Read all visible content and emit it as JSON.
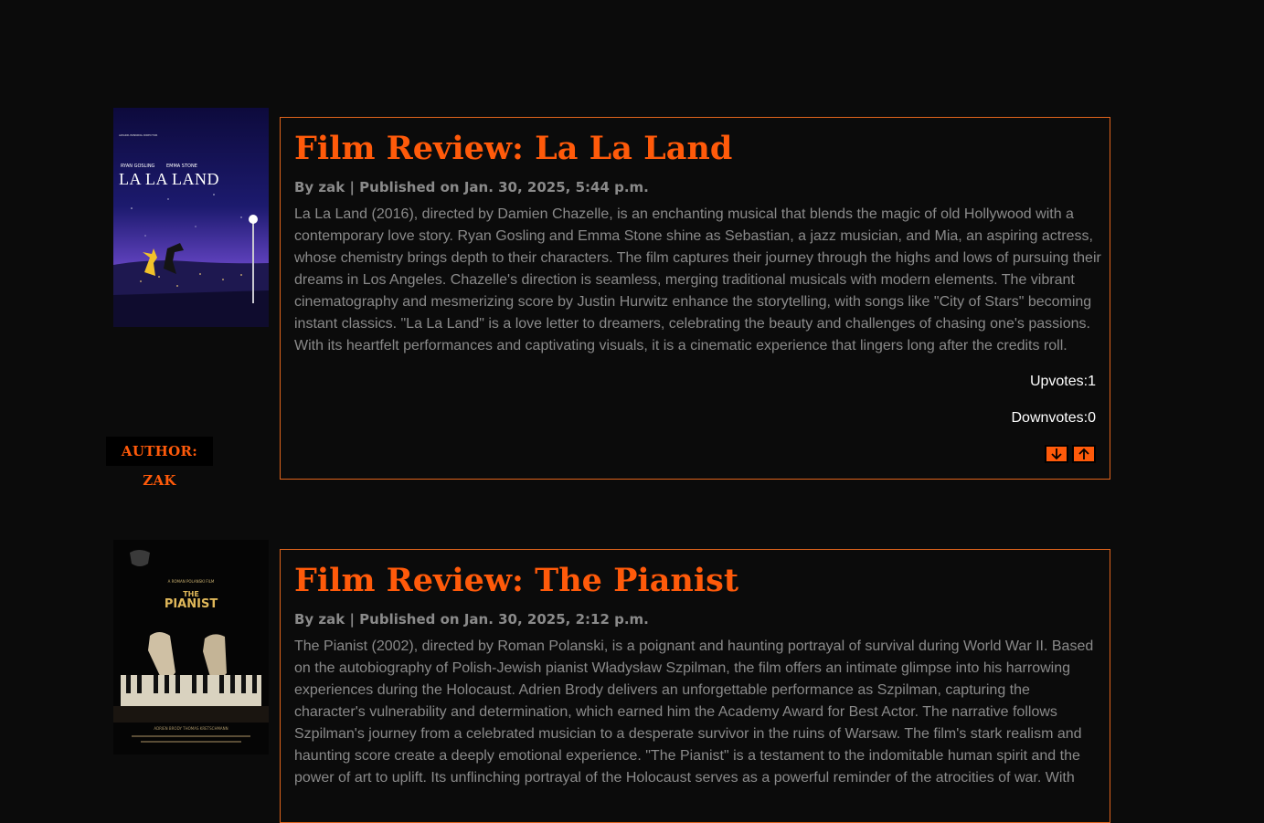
{
  "posts": [
    {
      "title": "Film Review: La La Land",
      "byline": "By zak | Published on Jan. 30, 2025, 5:44 p.m.",
      "body": "La La Land (2016), directed by Damien Chazelle, is an enchanting musical that blends the magic of old Hollywood with a contemporary love story. Ryan Gosling and Emma Stone shine as Sebastian, a jazz musician, and Mia, an aspiring actress, whose chemistry brings depth to their characters. The film captures their journey through the highs and lows of pursuing their dreams in Los Angeles. Chazelle's direction is seamless, merging traditional musicals with modern elements. The vibrant cinematography and mesmerizing score by Justin Hurwitz enhance the storytelling, with songs like \"City of Stars\" becoming instant classics. \"La La Land\" is a love letter to dreamers, celebrating the beauty and challenges of chasing one's passions. With its heartfelt performances and captivating visuals, it is a cinematic experience that lingers long after the credits roll.",
      "upvotes": "Upvotes:1",
      "downvotes": "Downvotes:0",
      "author_badge": "AUTHOR: ZAK",
      "poster": {
        "top_small_text": "AWARD-WINNING DIRECTOR",
        "actors_left": "RYAN GOSLING",
        "actors_right": "EMMA STONE",
        "title": "LA LA LAND"
      }
    },
    {
      "title": "Film Review: The Pianist",
      "byline": "By zak | Published on Jan. 30, 2025, 2:12 p.m.",
      "body": "The Pianist (2002), directed by Roman Polanski, is a poignant and haunting portrayal of survival during World War II. Based on the autobiography of Polish-Jewish pianist Władysław Szpilman, the film offers an intimate glimpse into his harrowing experiences during the Holocaust. Adrien Brody delivers an unforgettable performance as Szpilman, capturing the character's vulnerability and determination, which earned him the Academy Award for Best Actor. The narrative follows Szpilman's journey from a celebrated musician to a desperate survivor in the ruins of Warsaw. The film's stark realism and haunting score create a deeply emotional experience. \"The Pianist\" is a testament to the indomitable human spirit and the power of art to uplift. Its unflinching portrayal of the Holocaust serves as a powerful reminder of the atrocities of war. With",
      "poster": {
        "top_small_text": "A ROMAN POLANSKI FILM",
        "title_line1": "THE",
        "title_line2": "PIANIST",
        "credits": "ADRIEN BRODY   THOMAS KRETSCHMANN"
      }
    }
  ],
  "colors": {
    "background": "#0b0b0b",
    "accent": "#ff5a0a",
    "border": "#e0641c",
    "muted_text": "#8a8a8a",
    "vote_text": "#ffffff"
  },
  "icons": {
    "downvote": "arrow-down-icon",
    "upvote": "arrow-up-icon"
  }
}
